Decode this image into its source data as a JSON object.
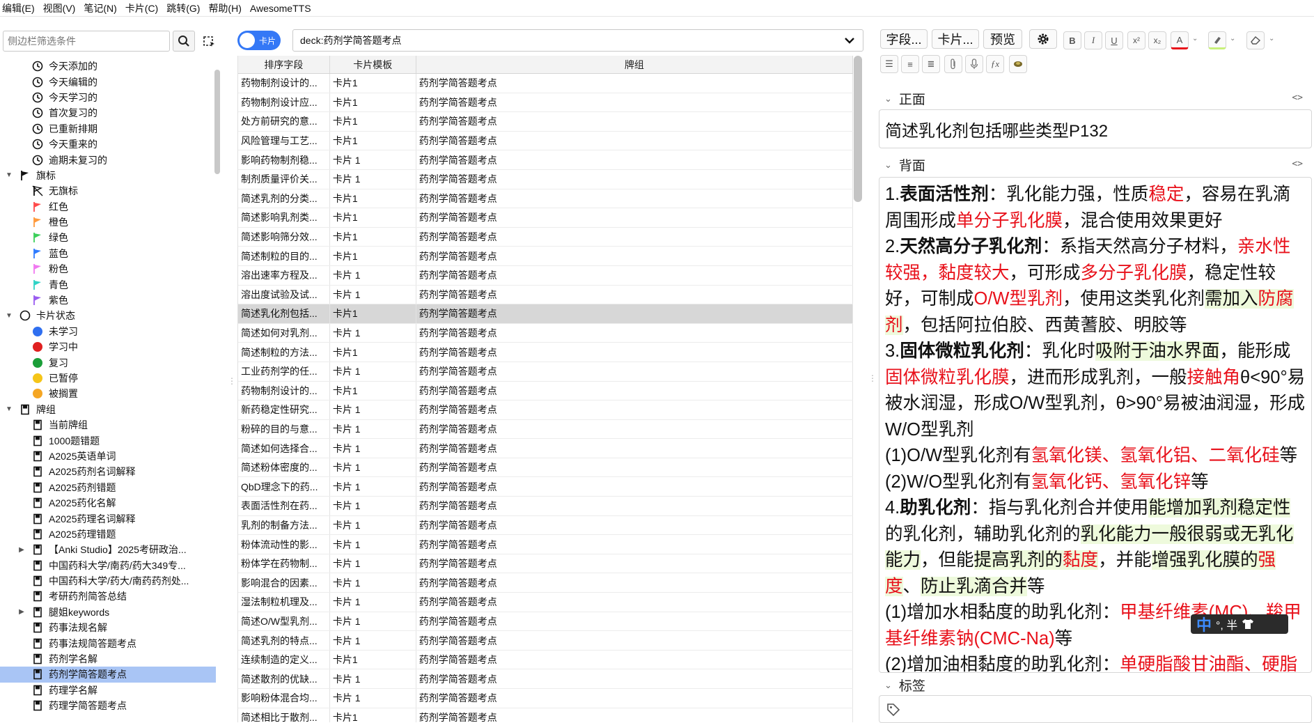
{
  "menubar": {
    "items": [
      "编辑(E)",
      "视图(V)",
      "笔记(N)",
      "卡片(C)",
      "跳转(G)",
      "帮助(H)",
      "AwesomeTTS"
    ]
  },
  "sidebar": {
    "search_placeholder": "侧边栏筛选条件",
    "today": [
      "今天添加的",
      "今天编辑的",
      "今天学习的",
      "首次复习的",
      "已重新排期",
      "今天重来的",
      "逾期未复习的"
    ],
    "flags_header": "旗标",
    "flags": [
      {
        "label": "无旗标",
        "color": "#222222"
      },
      {
        "label": "红色",
        "color": "#ff4a4a"
      },
      {
        "label": "橙色",
        "color": "#ff9a3c"
      },
      {
        "label": "绿色",
        "color": "#3ccf5a"
      },
      {
        "label": "蓝色",
        "color": "#2f7bff"
      },
      {
        "label": "粉色",
        "color": "#f078f0"
      },
      {
        "label": "青色",
        "color": "#2fd3c6"
      },
      {
        "label": "紫色",
        "color": "#9a5cf0"
      }
    ],
    "state_header": "卡片状态",
    "states": [
      {
        "label": "未学习",
        "color": "#2f6ff0"
      },
      {
        "label": "学习中",
        "color": "#e02020"
      },
      {
        "label": "复习",
        "color": "#1a9e38"
      },
      {
        "label": "已暂停",
        "color": "#f5c518"
      },
      {
        "label": "被搁置",
        "color": "#f5a623"
      }
    ],
    "decks_header": "牌组",
    "decks": [
      {
        "label": "当前牌组",
        "expandable": false,
        "selected": false
      },
      {
        "label": "1000题错题",
        "expandable": false,
        "selected": false
      },
      {
        "label": "A2025英语单词",
        "expandable": false,
        "selected": false
      },
      {
        "label": "A2025药剂名词解释",
        "expandable": false,
        "selected": false
      },
      {
        "label": "A2025药剂错题",
        "expandable": false,
        "selected": false
      },
      {
        "label": "A2025药化名解",
        "expandable": false,
        "selected": false
      },
      {
        "label": "A2025药理名词解释",
        "expandable": false,
        "selected": false
      },
      {
        "label": "A2025药理错题",
        "expandable": false,
        "selected": false
      },
      {
        "label": "【Anki Studio】2025考研政治...",
        "expandable": true,
        "selected": false
      },
      {
        "label": "中国药科大学/南药/药大349专...",
        "expandable": false,
        "selected": false
      },
      {
        "label": "中国药科大学/药大/南药药剂处...",
        "expandable": false,
        "selected": false
      },
      {
        "label": "考研药剂简答总结",
        "expandable": false,
        "selected": false
      },
      {
        "label": "腿姐keywords",
        "expandable": true,
        "selected": false
      },
      {
        "label": "药事法规名解",
        "expandable": false,
        "selected": false
      },
      {
        "label": "药事法规简答题考点",
        "expandable": false,
        "selected": false
      },
      {
        "label": "药剂学名解",
        "expandable": false,
        "selected": false
      },
      {
        "label": "药剂学简答题考点",
        "expandable": false,
        "selected": true
      },
      {
        "label": "药理学名解",
        "expandable": false,
        "selected": false
      },
      {
        "label": "药理学简答题考点",
        "expandable": false,
        "selected": false
      }
    ]
  },
  "browser": {
    "toggle_label": "卡片",
    "search_value": "deck:药剂学简答题考点",
    "columns": [
      "排序字段",
      "卡片模板",
      "牌组"
    ],
    "rows": [
      [
        "药物制剂设计的...",
        "卡片1",
        "药剂学简答题考点"
      ],
      [
        "药物制剂设计应...",
        "卡片1",
        "药剂学简答题考点"
      ],
      [
        "处方前研究的意...",
        "卡片1",
        "药剂学简答题考点"
      ],
      [
        "风险管理与工艺...",
        "卡片1",
        "药剂学简答题考点"
      ],
      [
        "影响药物制剂稳...",
        "卡片 1",
        "药剂学简答题考点"
      ],
      [
        "制剂质量评价关...",
        "卡片 1",
        "药剂学简答题考点"
      ],
      [
        "简述乳剂的分类...",
        "卡片1",
        "药剂学简答题考点"
      ],
      [
        "简述影响乳剂类...",
        "卡片1",
        "药剂学简答题考点"
      ],
      [
        "简述影响筛分效...",
        "卡片1",
        "药剂学简答题考点"
      ],
      [
        "简述制粒的目的...",
        "卡片1",
        "药剂学简答题考点"
      ],
      [
        "溶出速率方程及...",
        "卡片 1",
        "药剂学简答题考点"
      ],
      [
        "溶出度试验及试...",
        "卡片 1",
        "药剂学简答题考点"
      ],
      [
        "简述乳化剂包括...",
        "卡片1",
        "药剂学简答题考点"
      ],
      [
        "简述如何对乳剂...",
        "卡片 1",
        "药剂学简答题考点"
      ],
      [
        "简述制粒的方法...",
        "卡片1",
        "药剂学简答题考点"
      ],
      [
        "工业药剂学的任...",
        "卡片 1",
        "药剂学简答题考点"
      ],
      [
        "药物制剂设计的...",
        "卡片1",
        "药剂学简答题考点"
      ],
      [
        "新药稳定性研究...",
        "卡片 1",
        "药剂学简答题考点"
      ],
      [
        "粉碎的目的与意...",
        "卡片 1",
        "药剂学简答题考点"
      ],
      [
        "简述如何选择合...",
        "卡片 1",
        "药剂学简答题考点"
      ],
      [
        "简述粉体密度的...",
        "卡片 1",
        "药剂学简答题考点"
      ],
      [
        "QbD理念下的药...",
        "卡片 1",
        "药剂学简答题考点"
      ],
      [
        "表面活性剂在药...",
        "卡片 1",
        "药剂学简答题考点"
      ],
      [
        "乳剂的制备方法...",
        "卡片 1",
        "药剂学简答题考点"
      ],
      [
        "粉体流动性的影...",
        "卡片 1",
        "药剂学简答题考点"
      ],
      [
        "粉体学在药物制...",
        "卡片 1",
        "药剂学简答题考点"
      ],
      [
        "影响混合的因素...",
        "卡片 1",
        "药剂学简答题考点"
      ],
      [
        "湿法制粒机理及...",
        "卡片 1",
        "药剂学简答题考点"
      ],
      [
        "简述O/W型乳剂...",
        "卡片 1",
        "药剂学简答题考点"
      ],
      [
        "简述乳剂的特点...",
        "卡片 1",
        "药剂学简答题考点"
      ],
      [
        "连续制造的定义...",
        "卡片1",
        "药剂学简答题考点"
      ],
      [
        "简述散剂的优缺...",
        "卡片 1",
        "药剂学简答题考点"
      ],
      [
        "影响粉体混合均...",
        "卡片 1",
        "药剂学简答题考点"
      ],
      [
        "简述相比于散剂...",
        "卡片1",
        "药剂学简答题考点"
      ]
    ],
    "selected_row": 12
  },
  "editor": {
    "buttons": {
      "fields": "字段...",
      "cards": "卡片...",
      "preview": "预览"
    },
    "format_icons": {
      "bold": "B",
      "italic": "I",
      "underline": "U",
      "sup": "x²",
      "sub": "x₂",
      "color": "A",
      "fx": "ƒx"
    },
    "front_label": "正面",
    "front_value": "简述乳化剂包括哪些类型P132",
    "back_label": "背面",
    "tags_label": "标签",
    "ime": {
      "lang": "中",
      "mode": "°, 半"
    },
    "back_segments": [
      [
        {
          "t": "1."
        },
        {
          "t": "表面活性剂",
          "s": "b"
        },
        {
          "t": "：乳化能力强，性质"
        },
        {
          "t": "稳定",
          "s": "r"
        },
        {
          "t": "，容易在乳滴周围形成"
        },
        {
          "t": "单分子乳化膜",
          "s": "r"
        },
        {
          "t": "，混合使用效果更好"
        }
      ],
      [
        {
          "t": "2."
        },
        {
          "t": "天然高分子乳化剂",
          "s": "b"
        },
        {
          "t": "：系指天然高分子材料，"
        },
        {
          "t": "亲水性较强，黏度较大",
          "s": "r"
        },
        {
          "t": "，可形成"
        },
        {
          "t": "多分子乳化膜",
          "s": "r"
        },
        {
          "t": "，稳定性较好，可制成"
        },
        {
          "t": "O/W型乳剂",
          "s": "r"
        },
        {
          "t": "，使用这类乳化剂"
        },
        {
          "t": "需加入",
          "s": "h"
        },
        {
          "t": "防腐剂",
          "s": "rh"
        },
        {
          "t": "，包括阿拉伯胶、西黄蓍胶、明胶等"
        }
      ],
      [
        {
          "t": "3."
        },
        {
          "t": "固体微粒乳化剂",
          "s": "b"
        },
        {
          "t": "：乳化时"
        },
        {
          "t": "吸附于油水界面",
          "s": "h"
        },
        {
          "t": "，能形成"
        },
        {
          "t": "固体微粒乳化膜",
          "s": "r"
        },
        {
          "t": "，进而形成乳剂，一般"
        },
        {
          "t": "接触角",
          "s": "r"
        },
        {
          "t": "θ<90°易被水润湿，形成O/W型乳剂，θ>90°易被油润湿，形成W/O型乳剂"
        }
      ],
      [
        {
          "t": "(1)O/W型乳化剂有"
        },
        {
          "t": "氢氧化镁、氢氧化铝、二氧化硅",
          "s": "r"
        },
        {
          "t": "等"
        }
      ],
      [
        {
          "t": "(2)W/O型乳化剂有"
        },
        {
          "t": "氢氧化钙、氢氧化锌",
          "s": "r"
        },
        {
          "t": "等"
        }
      ],
      [
        {
          "t": "4."
        },
        {
          "t": "助乳化剂",
          "s": "b"
        },
        {
          "t": "：指与乳化剂合并使用"
        },
        {
          "t": "能增加乳剂稳定性",
          "s": "h"
        },
        {
          "t": "的乳化剂，辅助乳化剂的"
        },
        {
          "t": "乳化能力一般很弱或无乳化能力",
          "s": "h"
        },
        {
          "t": "，但能"
        },
        {
          "t": "提高乳剂的",
          "s": "h"
        },
        {
          "t": "黏度",
          "s": "rh"
        },
        {
          "t": "，并能"
        },
        {
          "t": "增强乳化膜的",
          "s": "h"
        },
        {
          "t": "强度",
          "s": "rh"
        },
        {
          "t": "、"
        },
        {
          "t": "防止乳滴合并",
          "s": "h"
        },
        {
          "t": "等"
        }
      ],
      [
        {
          "t": "(1)增加水相黏度的助乳化剂："
        },
        {
          "t": "甲基纤维素(MC)、羧甲基纤维素钠(CMC-Na)",
          "s": "r"
        },
        {
          "t": "等"
        }
      ],
      [
        {
          "t": "(2)增加油相黏度的助乳化剂："
        },
        {
          "t": "单硬脂酸甘油酯、硬脂酸",
          "s": "r"
        }
      ]
    ]
  }
}
